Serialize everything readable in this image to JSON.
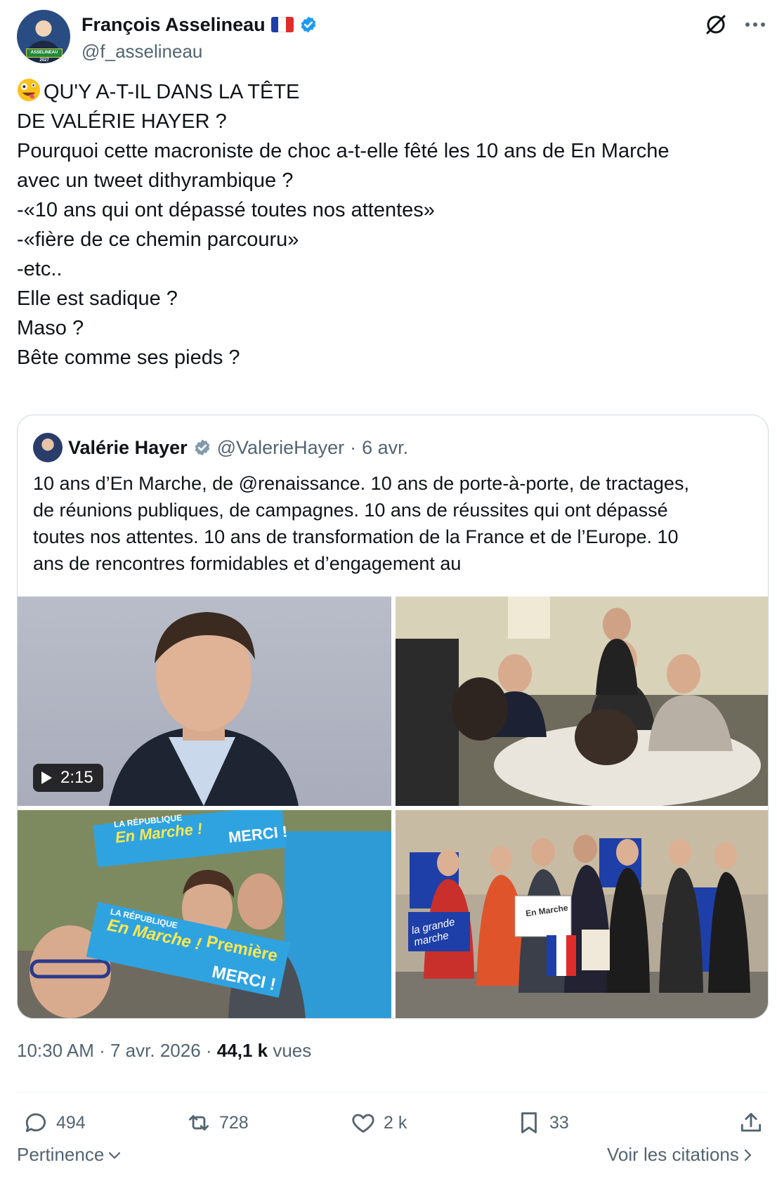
{
  "author": {
    "name": "François Asselineau",
    "handle": "@f_asselineau",
    "avatar_label": "ASSELINEAU 2027"
  },
  "tweet": {
    "lines": [
      "QU'Y A-T-IL DANS LA TÊTE",
      "DE VALÉRIE HAYER ?",
      "Pourquoi cette macroniste de choc a-t-elle fêté les 10 ans de En Marche",
      "avec un tweet dithyrambique ?",
      "-«10 ans qui ont dépassé toutes nos attentes»",
      "-«fière de ce chemin parcouru»",
      "-etc..",
      "Elle est sadique ?",
      "Maso ?",
      "Bête comme ses pieds ?"
    ]
  },
  "quote": {
    "name": "Valérie Hayer",
    "handle": "@ValerieHayer",
    "separator": "·",
    "date": "6 avr.",
    "lines": [
      "10 ans d’En Marche, de @renaissance. 10 ans de porte-à-porte, de tractages,",
      "de réunions publiques, de campagnes. 10 ans de réussites qui ont dépassé",
      "toutes nos attentes. 10 ans de transformation de la France et de l’Europe. 10",
      "ans de rencontres formidables et d’engagement au"
    ],
    "video_duration": "2:15",
    "banner_text_1": "LA RÉPUBLIQUE",
    "banner_text_2": "En Marche !",
    "banner_text_3": "MERCI !",
    "banner_text_4": "Première",
    "sign_text": "En Marche",
    "bag_text": "la grande marche"
  },
  "meta": {
    "time": "10:30 AM",
    "dot": "·",
    "date": "7 avr. 2026",
    "dot2": "·",
    "views_count": "44,1 k",
    "views_label": "vues"
  },
  "actions": {
    "replies": "494",
    "reposts": "728",
    "likes": "2 k",
    "bookmarks": "33"
  },
  "footer": {
    "sort_label": "Pertinence",
    "quotes_label": "Voir les citations"
  },
  "colors": {
    "verified": "#1d9bf0",
    "text": "#0f1419",
    "secondary": "#536471",
    "border": "#cfd9de"
  }
}
